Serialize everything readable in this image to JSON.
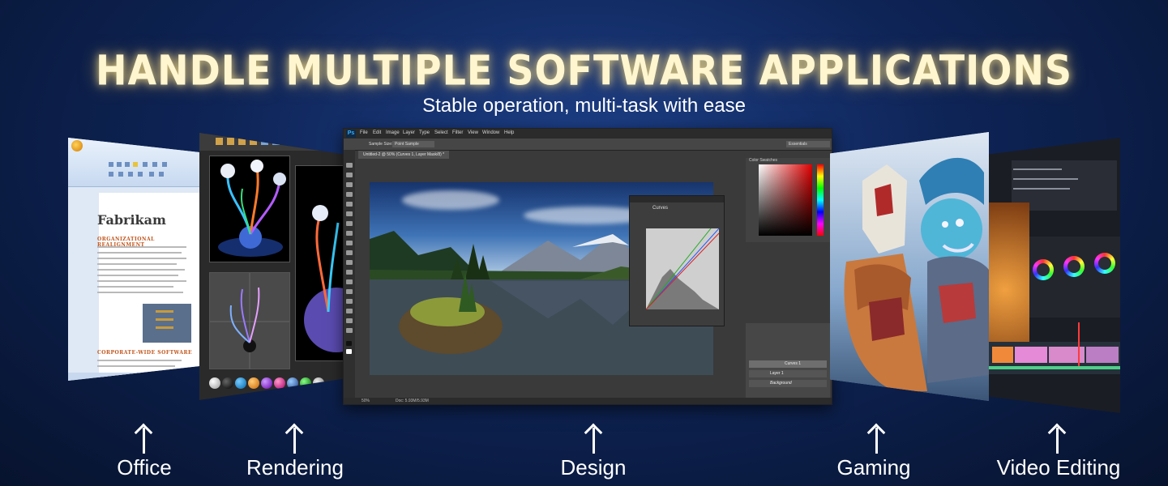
{
  "headline": "HANDLE MULTIPLE SOFTWARE APPLICATIONS",
  "subheadline": "Stable operation, multi-task with ease",
  "captions": {
    "office": "Office",
    "rendering": "Rendering",
    "design": "Design",
    "gaming": "Gaming",
    "video": "Video Editing"
  },
  "office_app": {
    "doc_title": "Fabrikam",
    "heading_1": "ORGANIZATIONAL REALIGNMENT",
    "heading_2": "CORPORATE-WIDE SOFTWARE"
  },
  "design_app": {
    "logo": "Ps",
    "menu": [
      "File",
      "Edit",
      "Image",
      "Layer",
      "Type",
      "Select",
      "Filter",
      "View",
      "Window",
      "Help"
    ],
    "options": [
      "Sample Size:",
      "Point Sample",
      "Essentials"
    ],
    "doc_tab": "Untitled-2 @ 50% (Curves 1, Layer Mask/8) *",
    "properties_title": "Curves",
    "color_tabs": "Color   Swatches",
    "layers": [
      "Curves 1",
      "Layer 1",
      "Background"
    ],
    "zoom": "50%",
    "doc_size": "Doc: 5.93M/5.93M"
  },
  "colors": {
    "headline_glow": "#ffe08a",
    "background": "#0e2456"
  },
  "icons": [
    "arrow-up-icon"
  ]
}
